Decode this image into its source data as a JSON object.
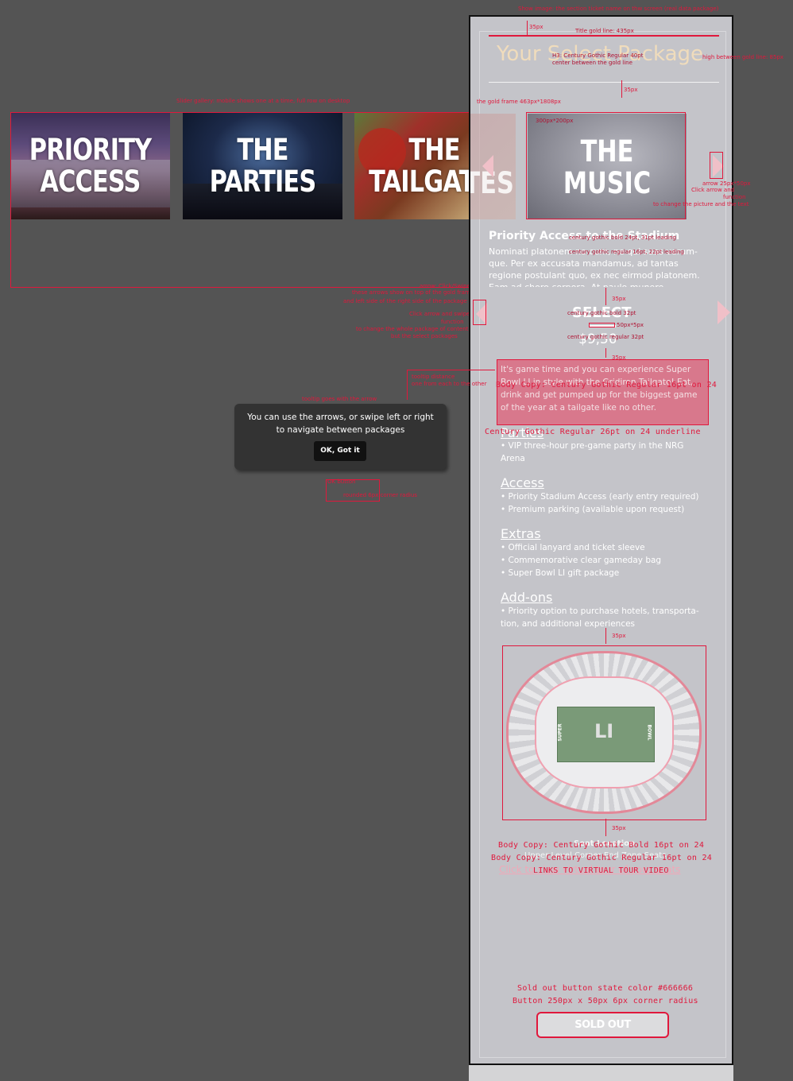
{
  "thumbs": [
    {
      "line1": "PRIORITY",
      "line2": "ACCESS"
    },
    {
      "line1": "THE",
      "line2": "PARTIES"
    },
    {
      "line1": "THE",
      "line2": "TAILGATES"
    },
    {
      "line1": "THE",
      "line2": "MUSIC"
    }
  ],
  "panel": {
    "title": "Your Select Package",
    "section_title": "Priority Access to the Stadium",
    "section_body": "Nominati platonem no cum, ne qui suas verum-que. Per ex accusata mandamus, ad tantas regione postulant quo, ex nec eirmod platonem. Eam ad choro corpora. At paulo munere accommodare his.",
    "select_label": "SELECT",
    "price": "$9,50",
    "intro": "It's game time and you can experience Super Bowl LI in style with the Gridiron Tailgate! Eat, drink and get pumped up for the biggest game of the year at a tailgate like no other.",
    "groups": [
      {
        "heading": "Parties",
        "items": [
          "• VIP three-hour pre-game party in the NRG",
          "Arena"
        ]
      },
      {
        "heading": "Access",
        "items": [
          "• Priority Stadium Access (early entry required)",
          "• Premium parking (available upon request)"
        ]
      },
      {
        "heading": "Extras",
        "items": [
          "• Official lanyard and ticket sleeve",
          "• Commemorative clear gameday bag",
          "• Super Bowl LI gift package"
        ]
      },
      {
        "heading": "Add-ons",
        "items": [
          "• Priority option to purchase hotels, transporta-",
          "tion, and additional experiences"
        ]
      }
    ],
    "seat_location": "Seat Location",
    "seat_value": "Upper Level Corner End Zone Seats",
    "tour_link": "Click to view virtual tour of your seats",
    "button": "SOLD OUT",
    "field_super": "SUPER",
    "field_bowl": "BOWL",
    "field_logo": "LI"
  },
  "tooltip": {
    "text": "You can use the arrows, or swipe left or right to navigate between packages",
    "ok": "OK, Got it"
  },
  "annotations": {
    "top_note": "Show image: the section ticket name on thw screen (real data package)",
    "dim_35_a": "35px",
    "title_gold_line": "Title gold line: 435px",
    "h3_note_1": "H3: Century Gothic Regular 40pt",
    "h3_note_2": "center between the gold line",
    "high_between": "high between gold line: 85px",
    "dim_35_b": "35px",
    "gold_frame": "the gold frame 463px*1808px",
    "carousel_note": "Slider gallery: mobile shows one at a time, full row on desktop",
    "thumb_size": "300px*200px",
    "arrow_1": "arrow 25px*50px",
    "arrow_2": "Click arrow and",
    "arrow_3": "function",
    "arrow_4": "to change the picture and the text",
    "sec_title_spec": "century gothic bold 24pt, 31pt leading",
    "sec_body_spec": "century gothic regular 16pt, 22pt leading",
    "arrow_note_1": "arrow: Click/Swipe",
    "arrow_note_2": "these arrows show on top of the gold frame",
    "arrow_note_3": "and left side of the right side of the package frame",
    "arrow_note_4": "Click arrow and swipe",
    "arrow_note_5": "function",
    "arrow_note_6": "to change the whole package of content",
    "arrow_note_7": "but the select packages",
    "dim_35_c": "35px",
    "select_spec": "century gothic bold 32pt",
    "line_spec": "50px*5px",
    "price_spec": "century gothic regular 32pt",
    "dim_35_d": "35px",
    "intro_note_1": "tooltip distance",
    "intro_note_2": "one from each to the other",
    "tooltip_note": "tooltip goes with the arrow",
    "body_copy_16": "Body Copy: Century Gothic Regular 16pt on 24",
    "sub_spec": "Century Gothic Regular 26pt on 24 underline",
    "btn_note_1": "OK button",
    "btn_note_2": "rounded 6px corner radius",
    "dim_35_e": "35px",
    "dim_35_f": "35px",
    "seat_spec_1": "Body Copy: Century Gothic Bold 16pt on 24",
    "seat_spec_2": "Body Copy: Century Gothic Regular 16pt on 24",
    "seat_spec_3": "LINKS TO VIRTUAL TOUR VIDEO",
    "sold_spec_1": "Sold out button state color #666666",
    "sold_spec_2": "Button 250px x 50px 6px corner radius"
  },
  "colors": {
    "accent": "#e0183c",
    "gold": "#e8cfa0",
    "sold_out": "#666666"
  }
}
